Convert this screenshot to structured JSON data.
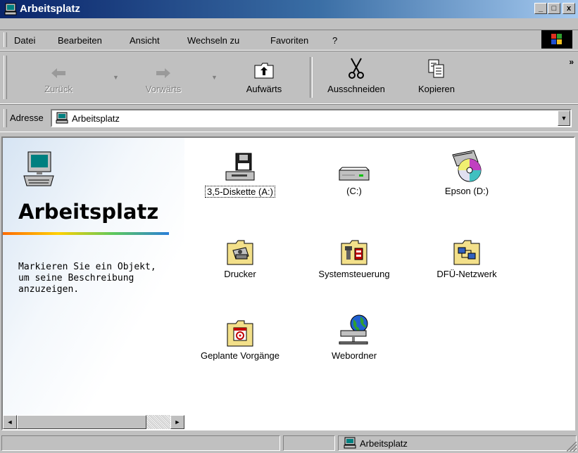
{
  "window": {
    "title": "Arbeitsplatz"
  },
  "title_buttons": {
    "minimize": "_",
    "maximize": "□",
    "close": "x"
  },
  "menu": [
    {
      "label": "Datei"
    },
    {
      "label": "Bearbeiten"
    },
    {
      "label": "Ansicht"
    },
    {
      "label": "Wechseln zu"
    },
    {
      "label": "Favoriten"
    },
    {
      "label": "?"
    }
  ],
  "toolbar": {
    "back_label": "Zurück",
    "forward_label": "Vorwärts",
    "up_label": "Aufwärts",
    "cut_label": "Ausschneiden",
    "copy_label": "Kopieren",
    "more": "»"
  },
  "address": {
    "label": "Adresse",
    "value": "Arbeitsplatz",
    "drop": "▼"
  },
  "left_panel": {
    "heading": "Arbeitsplatz",
    "description": "Markieren Sie ein Objekt, um seine Beschreibung anzuzeigen."
  },
  "items": [
    {
      "label": "3,5-Diskette (A:)",
      "icon": "floppy-drive-icon"
    },
    {
      "label": "(C:)",
      "icon": "hard-drive-icon"
    },
    {
      "label": "Epson (D:)",
      "icon": "cd-drive-icon"
    },
    {
      "label": "Drucker",
      "icon": "printers-folder-icon"
    },
    {
      "label": "Systemsteuerung",
      "icon": "control-panel-folder-icon"
    },
    {
      "label": "DFÜ-Netzwerk",
      "icon": "dialup-network-folder-icon"
    },
    {
      "label": "Geplante Vorgänge",
      "icon": "scheduled-tasks-folder-icon"
    },
    {
      "label": "Webordner",
      "icon": "web-folders-icon"
    }
  ],
  "scrollbar": {
    "left_arrow": "◄",
    "right_arrow": "►"
  },
  "status": {
    "text": "Arbeitsplatz"
  },
  "colors": {
    "titlebar_start": "#0a246a",
    "titlebar_end": "#a6caf0",
    "face": "#c0c0c0"
  }
}
